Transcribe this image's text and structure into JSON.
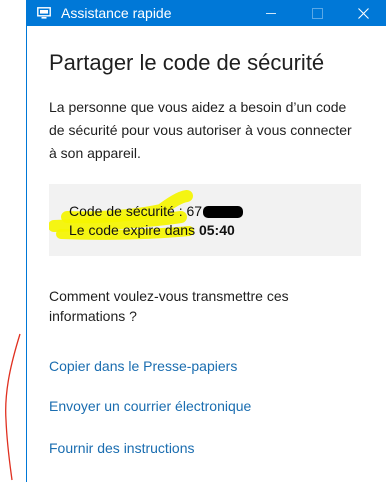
{
  "window": {
    "title": "Assistance rapide",
    "icon": "remote-assistance-icon",
    "controls": [
      "minimize-icon",
      "maximize-icon",
      "close-icon"
    ],
    "accent_color": "#0078d7"
  },
  "main": {
    "heading": "Partager le code de sécurité",
    "intro": "La personne que vous aidez a besoin d’un code de sécurité pour vous autoriser à vous connecter à son appareil.",
    "code_box": {
      "code_label": "Code de sécurité :",
      "code_visible_part": "67",
      "expire_label": "Le code expire dans",
      "expire_time": "05:40",
      "highlight_color": "#f5f500"
    },
    "question": "Comment voulez-vous transmettre ces informations ?",
    "links": [
      "Copier dans le Presse-papiers",
      "Envoyer un courrier électronique",
      "Fournir des instructions"
    ],
    "link_color": "#1a6db0"
  }
}
